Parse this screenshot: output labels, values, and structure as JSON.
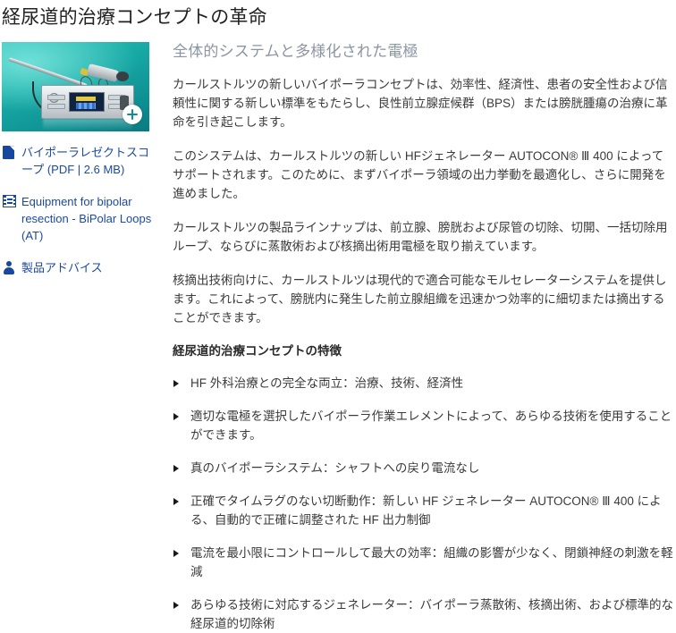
{
  "page": {
    "title": "経尿道的治療コンセプトの革命"
  },
  "media": {
    "alt_name": "bipolar-resectoscope-and-autocon-generator",
    "zoom_button_label": "+",
    "background_color": "#17a8a4"
  },
  "sidebar": {
    "links": [
      {
        "icon": "pdf-document-icon",
        "label": "バイポーラレゼクトスコープ  (PDF | 2.6 MB)",
        "name": "link-bipolar-resectoscope-pdf"
      },
      {
        "icon": "video-film-icon",
        "label": "Equipment for bipolar resection - BiPolar Loops (AT)",
        "name": "link-equipment-bipolar-resection-video"
      },
      {
        "icon": "person-icon",
        "label": "製品アドバイス",
        "name": "link-product-advice"
      }
    ]
  },
  "main": {
    "section_title": "全体的システムと多様化された電極",
    "paragraphs": [
      "カールストルツの新しいバイポーラコンセプトは、効率性、経済性、患者の安全性および信頼性に関する新しい標準をもたらし、良性前立腺症候群（BPS）または膀胱腫瘍の治療に革命を引き起こします。",
      "このシステムは、カールストルツの新しい HFジェネレーター AUTOCON® Ⅲ 400 によってサポートされます。このために、まずバイポーラ領域の出力挙動を最適化し、さらに開発を進めました。",
      "カールストルツの製品ラインナップは、前立腺、膀胱および尿管の切除、切開、一括切除用ループ、ならびに蒸散術および核摘出術用電極を取り揃えています。",
      "核摘出技術向けに、カールストルツは現代的で適合可能なモルセレーターシステムを提供します。これによって、膀胱内に発生した前立腺組織を迅速かつ効率的に細切または摘出することができます。"
    ],
    "features_heading": "経尿道的治療コンセプトの特徴",
    "features": [
      "HF 外科治療との完全な両立：治療、技術、経済性",
      "適切な電極を選択したバイポーラ作業エレメントによって、あらゆる技術を使用することができます。",
      "真のバイポーラシステム：シャフトへの戻り電流なし",
      "正確でタイムラグのない切断動作：新しい HF ジェネレーター AUTOCON® Ⅲ 400 による、自動的で正確に調整された HF 出力制御",
      "電流を最小限にコントロールして最大の効率：組織の影響が少なく、閉鎖神経の刺激を軽減",
      "あらゆる技術に対応するジェネレーター：バイポーラ蒸散術、核摘出術、および標準的な経尿道的切除術"
    ]
  },
  "colors": {
    "link": "#1b4aa0",
    "section_title": "#8b95a3",
    "body_text": "#3a3a3a",
    "title": "#222222"
  }
}
